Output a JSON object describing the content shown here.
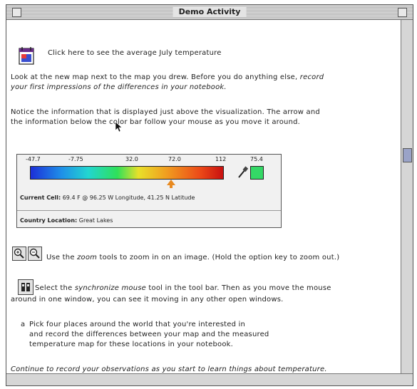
{
  "window": {
    "title": "Demo Activity"
  },
  "intro": {
    "line": "Click here to see the average July temperature"
  },
  "para1": {
    "line1_a": "Look at the new map next to the map you drew. Before you do anything else,",
    "line1_b": "record",
    "line2": "your first impressions of the differences in your notebook."
  },
  "para2": {
    "line1": "Notice the information that is displayed just above the visualization.  The arrow and",
    "line2": "the information below the color bar follow your mouse as you move it around."
  },
  "legend": {
    "ticks": [
      "-47.7",
      "-7.75",
      "32.0",
      "72.0",
      "112",
      "75.4"
    ],
    "current_cell_label": "Current Cell:",
    "current_cell_value": "69.4 F @ 96.25 W Longitude, 41.25 N Latitude",
    "country_label": "Country Location:",
    "country_value": "Great Lakes",
    "colors": {
      "swatch": "#34d866",
      "arrow": "#e88a20"
    }
  },
  "zoom": {
    "text_a": "Use the",
    "text_b": "zoom",
    "text_c": "tools to zoom in on an image.  (Hold the option key to zoom out.)"
  },
  "sync": {
    "line1_a": "Select the",
    "line1_b": "synchronize mouse",
    "line1_c": "tool in the tool bar.  Then as you move the mouse",
    "line2": "around in one window, you can see it moving in any other open windows."
  },
  "bullet": {
    "marker": "a",
    "line1": "Pick four places around the world that you're interested in",
    "line2": "and record the differences between your map and the measured",
    "line3": "temperature map for these locations in your notebook."
  },
  "closing": "Continue to record your observations as you start to learn things about temperature."
}
